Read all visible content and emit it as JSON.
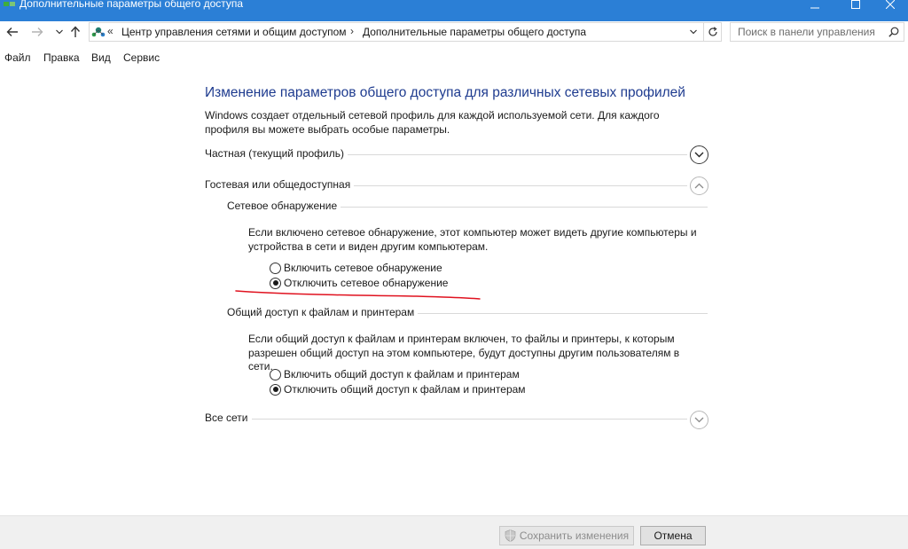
{
  "window": {
    "title": "Дополнительные параметры общего доступа"
  },
  "address": {
    "overflow": "«",
    "crumbs": [
      "Центр управления сетями и общим доступом",
      "Дополнительные параметры общего доступа"
    ],
    "separator": "›"
  },
  "search": {
    "placeholder": "Поиск в панели управления"
  },
  "menu": {
    "items": [
      "Файл",
      "Правка",
      "Вид",
      "Сервис"
    ]
  },
  "content": {
    "title": "Изменение параметров общего доступа для различных сетевых профилей",
    "intro": "Windows создает отдельный сетевой профиль для каждой используемой сети. Для каждого профиля вы можете выбрать особые параметры.",
    "profiles": [
      {
        "label": "Частная (текущий профиль)",
        "expanded": false
      },
      {
        "label": "Гостевая или общедоступная",
        "expanded": true
      },
      {
        "label": "Все сети",
        "expanded": false
      }
    ],
    "discovery": {
      "heading": "Сетевое обнаружение",
      "description": "Если включено сетевое обнаружение, этот компьютер может видеть другие компьютеры и устройства в сети и виден другим компьютерам.",
      "options": [
        {
          "label": "Включить сетевое обнаружение",
          "selected": false
        },
        {
          "label": "Отключить сетевое обнаружение",
          "selected": true
        }
      ]
    },
    "sharing": {
      "heading": "Общий доступ к файлам и принтерам",
      "description": "Если общий доступ к файлам и принтерам включен, то файлы и принтеры, к которым разрешен общий доступ на этом компьютере, будут доступны другим пользователям в сети.",
      "options": [
        {
          "label": "Включить общий доступ к файлам и принтерам",
          "selected": false
        },
        {
          "label": "Отключить общий доступ к файлам и принтерам",
          "selected": true
        }
      ]
    }
  },
  "footer": {
    "save_label": "Сохранить изменения",
    "cancel_label": "Отмена"
  },
  "colors": {
    "titlebar": "#2b7fd6",
    "heading": "#1e3b8f",
    "annotation": "#e0121f"
  },
  "icons": {
    "app": "network-icon",
    "back": "back-arrow-icon",
    "forward": "forward-arrow-icon",
    "recent": "chevron-down-icon",
    "up": "up-arrow-icon",
    "refresh": "refresh-icon",
    "search": "search-icon",
    "save": "uac-shield-icon"
  }
}
